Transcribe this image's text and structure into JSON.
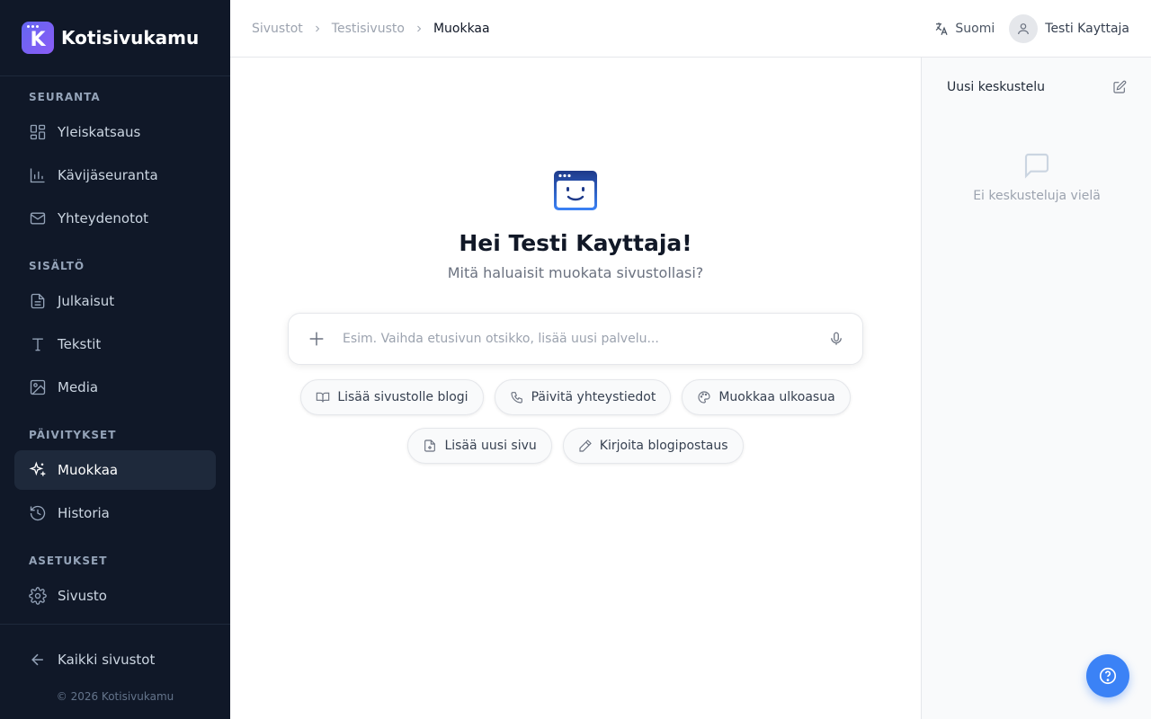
{
  "brand": {
    "name": "Kotisivukamu",
    "logo_letter": "K"
  },
  "sidebar": {
    "sections": [
      {
        "title": "SEURANTA"
      },
      {
        "title": "SISÄLTÖ"
      },
      {
        "title": "PÄIVITYKSET"
      },
      {
        "title": "ASETUKSET"
      }
    ],
    "items": [
      {
        "label": "Yleiskatsaus",
        "icon": "dashboard-icon"
      },
      {
        "label": "Kävijäseuranta",
        "icon": "bar-chart-icon"
      },
      {
        "label": "Yhteydenotot",
        "icon": "mail-icon"
      },
      {
        "label": "Julkaisut",
        "icon": "document-icon"
      },
      {
        "label": "Tekstit",
        "icon": "text-icon"
      },
      {
        "label": "Media",
        "icon": "image-icon"
      },
      {
        "label": "Muokkaa",
        "icon": "sparkles-icon",
        "active": true
      },
      {
        "label": "Historia",
        "icon": "history-icon"
      },
      {
        "label": "Sivusto",
        "icon": "gear-icon"
      }
    ],
    "back_label": "Kaikki sivustot",
    "copyright": "© 2026 Kotisivukamu"
  },
  "breadcrumb": [
    "Sivustot",
    "Testisivusto",
    "Muokkaa"
  ],
  "topbar": {
    "language": "Suomi",
    "user_name": "Testi Kayttaja"
  },
  "main": {
    "greeting": "Hei Testi Kayttaja!",
    "subtitle": "Mitä haluaisit muokata sivustollasi?",
    "prompt_placeholder": "Esim. Vaihda etusivun otsikko, lisää uusi palvelu...",
    "suggestions_row1": [
      {
        "label": "Lisää sivustolle blogi",
        "icon": "book-icon"
      },
      {
        "label": "Päivitä yhteystiedot",
        "icon": "phone-icon"
      },
      {
        "label": "Muokkaa ulkoasua",
        "icon": "palette-icon"
      }
    ],
    "suggestions_row2": [
      {
        "label": "Lisää uusi sivu",
        "icon": "file-plus-icon"
      },
      {
        "label": "Kirjoita blogipostaus",
        "icon": "pencil-icon"
      }
    ]
  },
  "right_panel": {
    "new_conversation": "Uusi keskustelu",
    "empty_text": "Ei keskusteluja vielä"
  },
  "colors": {
    "sidebar_bg": "#101828",
    "accent": "#3b82f6",
    "brand_gradient_start": "#6366f1",
    "brand_gradient_end": "#8b5cf6"
  }
}
